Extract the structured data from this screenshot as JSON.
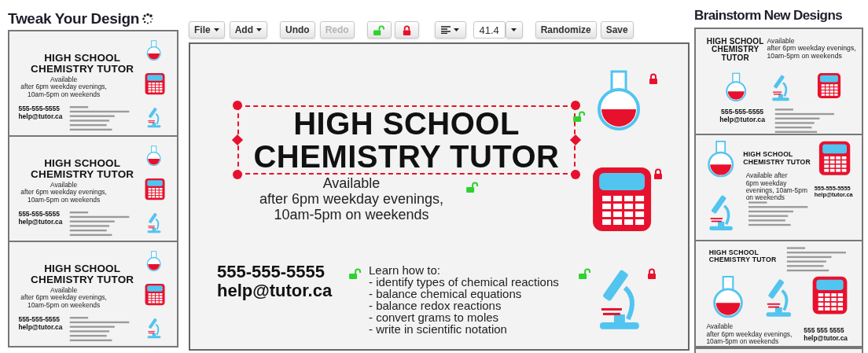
{
  "left_panel": {
    "title": "Tweak Your Design",
    "designs": [
      {
        "kind": "stacked",
        "title": [
          "HIGH SCHOOL",
          "CHEMISTRY TUTOR"
        ],
        "availability": [
          "Available",
          "after 6pm weekday evenings,",
          "10am-5pm on weekends"
        ],
        "phone": "555-555-5555",
        "email": "help@tutor.ca",
        "icons": [
          {
            "kind": "flask"
          },
          {
            "kind": "calculator"
          },
          {
            "kind": "microscope"
          }
        ]
      },
      {
        "kind": "stacked",
        "title": [
          "HIGH SCHOOL",
          "CHEMISTRY TUTOR"
        ],
        "availability": [
          "Available",
          "after 6pm weekday evenings,",
          "10am-5pm on weekends"
        ],
        "phone": "555-555-5555",
        "email": "help@tutor.ca",
        "icons": [
          {
            "kind": "flask"
          },
          {
            "kind": "calculator"
          },
          {
            "kind": "microscope"
          }
        ]
      },
      {
        "kind": "stacked",
        "title": [
          "HIGH SCHOOL",
          "CHEMISTRY TUTOR"
        ],
        "availability": [
          "Available",
          "after 6pm weekday evenings,",
          "10am-5pm on weekends"
        ],
        "phone": "555-555-5555",
        "email": "help@tutor.ca",
        "icons": [
          {
            "kind": "flask"
          },
          {
            "kind": "calculator"
          },
          {
            "kind": "microscope"
          }
        ]
      }
    ]
  },
  "toolbar": {
    "file": "File",
    "add": "Add",
    "undo": "Undo",
    "redo": {
      "label": "Redo",
      "disabled": true
    },
    "font_size": "41.4",
    "randomize": "Randomize",
    "save": "Save"
  },
  "editor": {
    "kind": "stacked",
    "title": [
      "HIGH SCHOOL",
      "CHEMISTRY TUTOR"
    ],
    "title_locked": false,
    "title_selected": true,
    "availability": [
      "Available",
      "after 6pm weekday evenings,",
      "10am-5pm on weekends"
    ],
    "availability_locked": false,
    "phone": "555-555-5555",
    "email": "help@tutor.ca",
    "contact_locked": false,
    "learn": [
      "Learn how to:",
      "- identify types of chemical reactions",
      "- balance chemical equations",
      "- balance redox reactions",
      "- convert grams to moles",
      "- write in scientific notation"
    ],
    "learn_locked": false,
    "icons": [
      {
        "kind": "flask",
        "locked": true
      },
      {
        "kind": "calculator",
        "locked": true
      },
      {
        "kind": "microscope",
        "locked": true
      }
    ]
  },
  "right_panel": {
    "title": "Brainstorm New Designs",
    "designs": [
      {
        "kind": "row_icons",
        "title": [
          "HIGH SCHOOL",
          "CHEMISTRY",
          "TUTOR"
        ],
        "availability": [
          "Available",
          "after 6pm weekday evenings,",
          "10am-5pm on weekends"
        ],
        "phone": "555-555-5555",
        "email": "help@tutor.ca",
        "icons": [
          {
            "kind": "flask"
          },
          {
            "kind": "microscope"
          },
          {
            "kind": "calculator"
          }
        ]
      },
      {
        "kind": "split",
        "title": [
          "HIGH SCHOOL",
          "CHEMISTRY TUTOR"
        ],
        "availability": [
          "Available after",
          "6pm weekday",
          "evenings, 10am-5pm",
          "on weekends"
        ],
        "phone": "555-555-5555",
        "email": "help@tutor.ca",
        "icons": [
          {
            "kind": "flask"
          },
          {
            "kind": "calculator"
          },
          {
            "kind": "microscope"
          }
        ]
      },
      {
        "kind": "bottom_icons",
        "title": [
          "HIGH SCHOOL",
          "CHEMISTRY TUTOR"
        ],
        "availability": [
          "Available",
          "after 6pm weekday evenings,",
          "10am-5pm on weekends"
        ],
        "phone": "555 555 5555",
        "email": "help@tutor.ca",
        "icons": [
          {
            "kind": "flask"
          },
          {
            "kind": "microscope"
          },
          {
            "kind": "calculator"
          }
        ]
      },
      {
        "kind": "cut_off"
      }
    ]
  }
}
